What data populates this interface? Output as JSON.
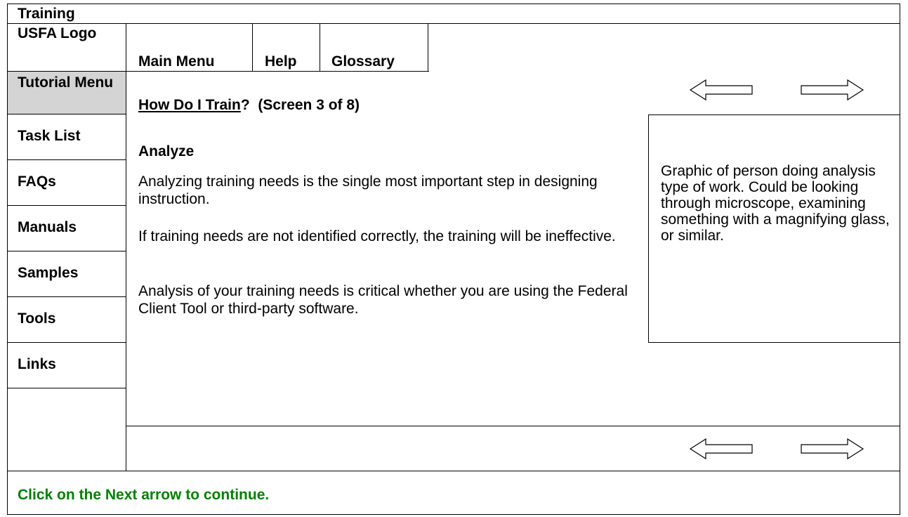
{
  "header": {
    "title": "Training",
    "logo_text": "USFA Logo"
  },
  "top_nav": {
    "main_menu": "Main Menu",
    "help": "Help",
    "glossary": "Glossary"
  },
  "sidebar": {
    "items": [
      {
        "label": "Tutorial Menu"
      },
      {
        "label": "Task List"
      },
      {
        "label": "FAQs"
      },
      {
        "label": "Manuals"
      },
      {
        "label": "Samples"
      },
      {
        "label": "Tools"
      },
      {
        "label": "Links"
      }
    ]
  },
  "content": {
    "title_link": "How Do I Train",
    "title_rest": "?  (Screen 3 of 8)",
    "section_heading": "Analyze",
    "paragraphs": [
      "Analyzing training needs is the single most important step in designing instruction.",
      "If training needs are not identified correctly, the training will be ineffective.",
      "Analysis of your training needs is critical whether you are using the Federal Client Tool or third-party software."
    ],
    "graphic_placeholder": "Graphic of person doing analysis type of work. Could be looking through microscope, examining something with a magnifying glass, or similar."
  },
  "navigation_arrows": {
    "back_icon": "left-arrow-icon",
    "next_icon": "right-arrow-icon"
  },
  "footer": {
    "instruction": "Click on the Next arrow to continue.",
    "instruction_color": "#008000"
  },
  "colors": {
    "tutorial_menu_bg": "#d4d4d4",
    "border": "#000000"
  }
}
